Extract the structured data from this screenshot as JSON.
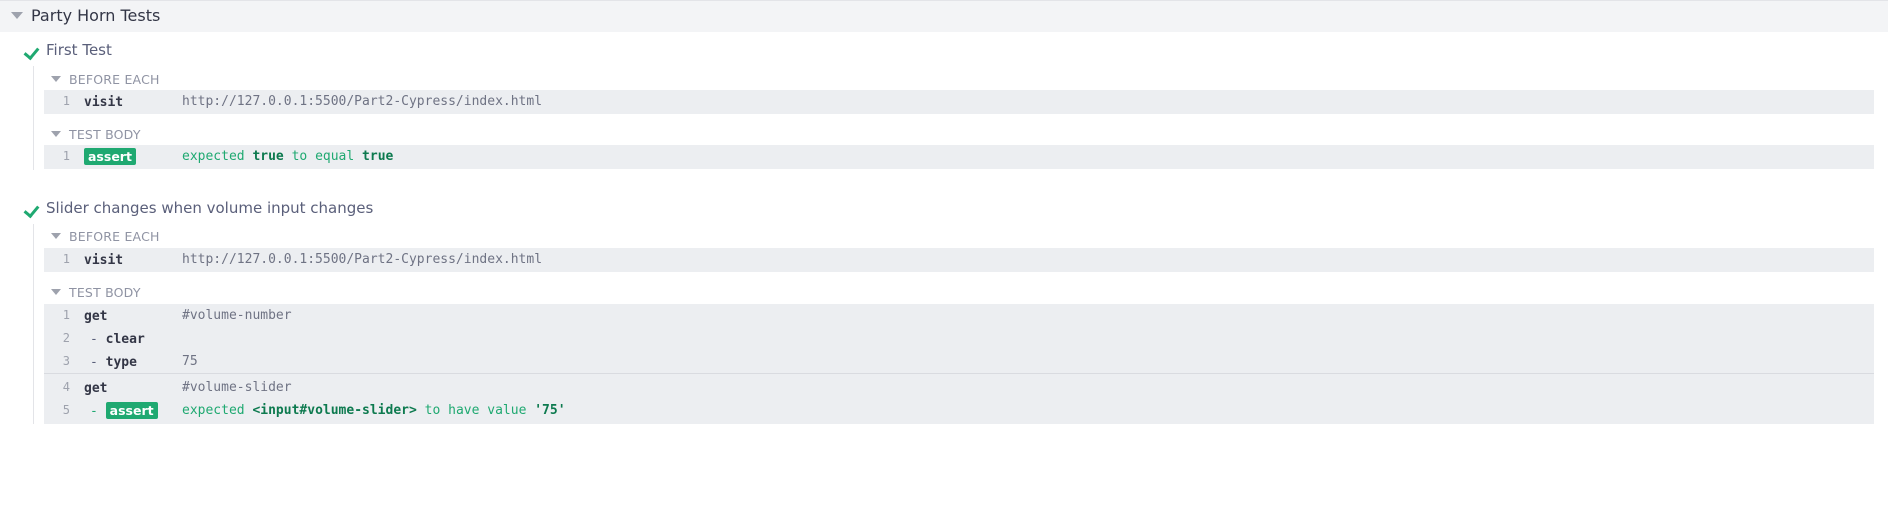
{
  "suite": {
    "title": "Party Horn Tests"
  },
  "tests": [
    {
      "title": "First Test",
      "before_each": {
        "label": "BEFORE EACH",
        "commands": [
          {
            "num": "1",
            "name": "visit",
            "message": "http://127.0.0.1:5500/Part2-Cypress/index.html"
          }
        ]
      },
      "test_body": {
        "label": "TEST BODY",
        "commands": [
          {
            "num": "1",
            "name": "assert",
            "msg_parts": [
              "expected",
              "true",
              "to equal",
              "true"
            ]
          }
        ]
      }
    },
    {
      "title": "Slider changes when volume input changes",
      "before_each": {
        "label": "BEFORE EACH",
        "commands": [
          {
            "num": "1",
            "name": "visit",
            "message": "http://127.0.0.1:5500/Part2-Cypress/index.html"
          }
        ]
      },
      "test_body": {
        "label": "TEST BODY",
        "commands": [
          {
            "num": "1",
            "name": "get",
            "message": "#volume-number"
          },
          {
            "num": "2",
            "dash": "-",
            "name": "clear",
            "message": ""
          },
          {
            "num": "3",
            "dash": "-",
            "name": "type",
            "message": "75"
          },
          {
            "num": "4",
            "name": "get",
            "message": "#volume-slider"
          },
          {
            "num": "5",
            "dash": "-",
            "name": "assert",
            "msg_parts": [
              "expected",
              "<input#volume-slider>",
              "to have value",
              "'75'"
            ]
          }
        ]
      }
    }
  ],
  "colors": {
    "pass": "#1fa971",
    "command_bg": "#eceef1"
  }
}
